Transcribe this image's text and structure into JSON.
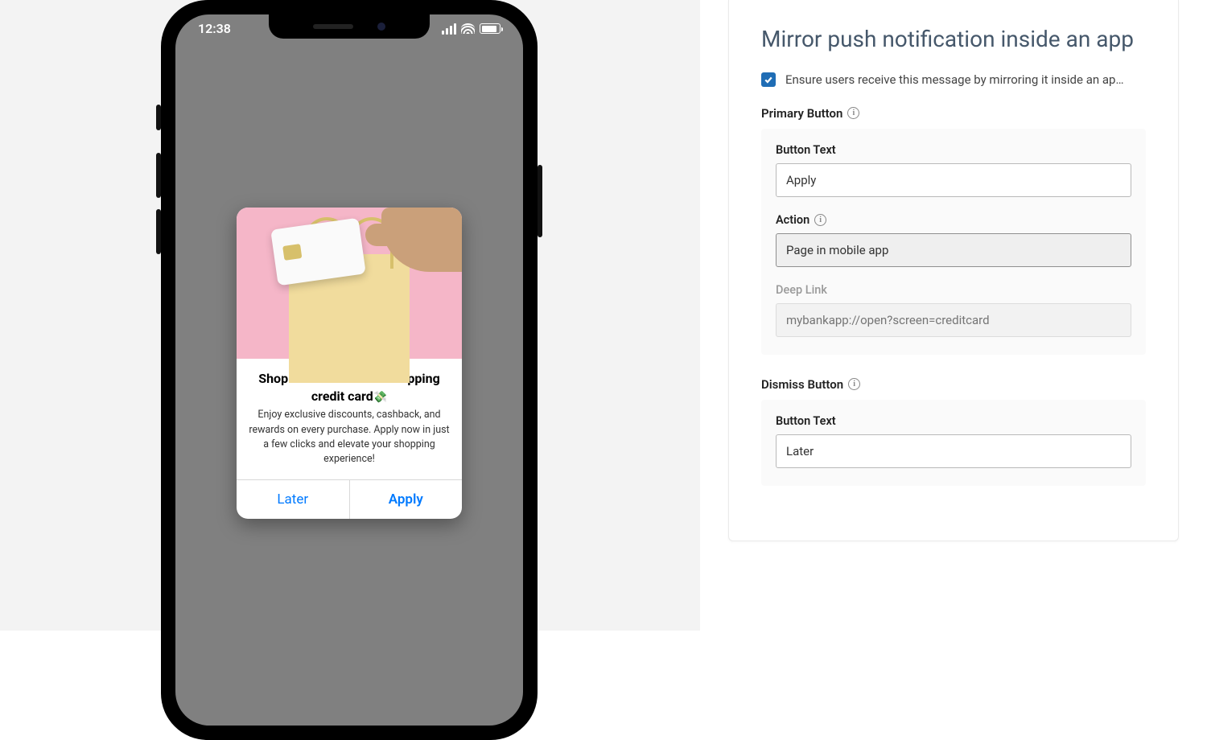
{
  "preview": {
    "status_time": "12:38",
    "modal": {
      "title": "Shop smarter with our shipping credit card",
      "emoji": "💸",
      "description": "Enjoy exclusive discounts, cashback, and rewards on every purchase. Apply now in just a few clicks and elevate your shopping experience!",
      "dismiss_label": "Later",
      "primary_label": "Apply"
    }
  },
  "settings": {
    "title": "Mirror push notification inside an app",
    "mirror_checkbox_label": "Ensure users receive this message by mirroring it inside an ap…",
    "mirror_checked": true,
    "primary_button": {
      "header": "Primary Button",
      "text_label": "Button Text",
      "text_value": "Apply",
      "action_label": "Action",
      "action_value": "Page in mobile app",
      "deeplink_label": "Deep Link",
      "deeplink_placeholder": "mybankapp://open?screen=creditcard"
    },
    "dismiss_button": {
      "header": "Dismiss Button",
      "text_label": "Button Text",
      "text_value": "Later"
    }
  }
}
